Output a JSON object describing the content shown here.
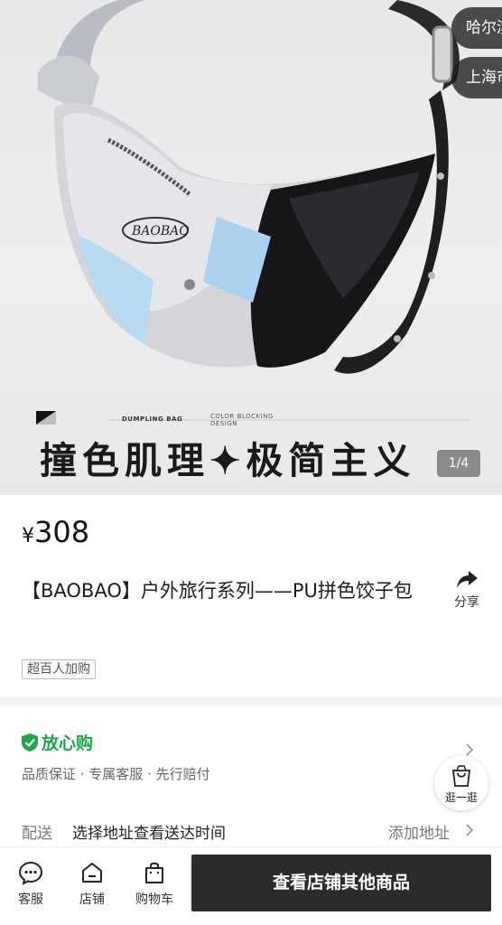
{
  "hero": {
    "banner_text": "撞色肌理✦极简主义",
    "banner_small_1": "DUMPLING BAG",
    "banner_small_2": "COLOR BLOCKING DESIGN",
    "logo_text": "BAOBAO",
    "counter": "1/4",
    "locations": [
      "哈尔滨",
      "上海市"
    ]
  },
  "product": {
    "currency": "¥",
    "price": "308",
    "title": "【BAOBAO】户外旅行系列——PU拼色饺子包",
    "share_label": "分享",
    "badge": "超百人加购"
  },
  "assurance": {
    "title": "放心购",
    "subtitle": "品质保证 · 专属客服 · 先行赔付",
    "browse_label": "逛一逛"
  },
  "delivery": {
    "label": "配送",
    "value": "选择地址查看送达时间",
    "add_address": "添加地址"
  },
  "bottom_bar": {
    "service": "客服",
    "store": "店铺",
    "cart": "购物车",
    "cta": "查看店铺其他商品"
  },
  "colors": {
    "accent_green": "#1fa64a",
    "cta_bg": "#2b2b2b"
  }
}
